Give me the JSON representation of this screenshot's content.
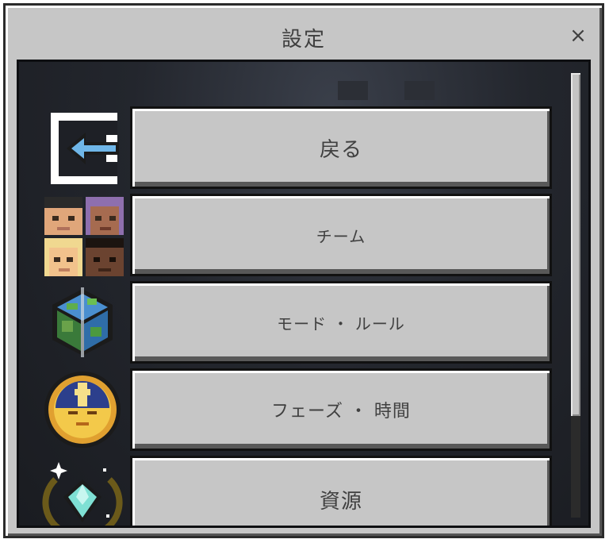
{
  "dialog": {
    "title": "設定",
    "close_label": "×"
  },
  "menu": {
    "items": [
      {
        "label": "戻る",
        "icon": "back-arrow-icon"
      },
      {
        "label": "チーム",
        "icon": "team-faces-icon"
      },
      {
        "label": "モード ・ ルール",
        "icon": "world-cube-icon"
      },
      {
        "label": "フェーズ ・ 時間",
        "icon": "sun-clock-icon"
      },
      {
        "label": "資源",
        "icon": "diamond-gem-icon"
      }
    ]
  },
  "scrollbar": {
    "position_fraction": 0.0,
    "visible_fraction": 0.77
  },
  "colors": {
    "panel": "#c6c6c6",
    "content_bg": "#1e2026",
    "button_text": "#404040",
    "arrow_blue": "#6fb6e8"
  }
}
